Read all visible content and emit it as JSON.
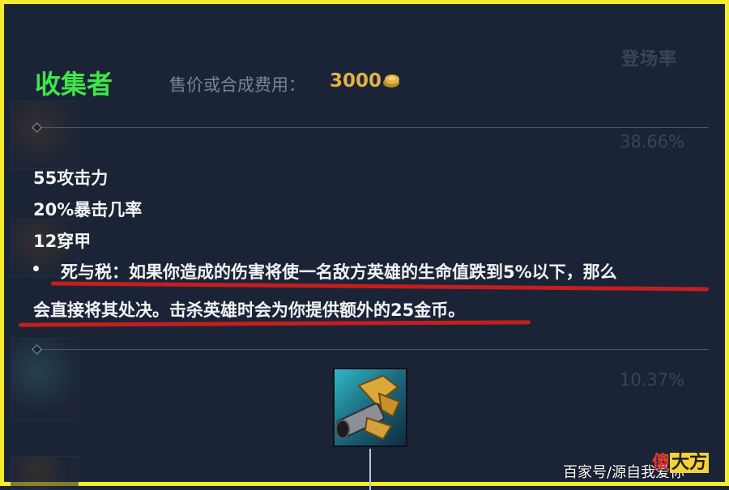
{
  "background_table": {
    "header": "登场率",
    "rates": [
      "38.66%",
      "",
      "10.37%"
    ]
  },
  "item": {
    "name": "收集者",
    "price_label": "售价或合成费用：",
    "price": "3000",
    "stats": [
      "55攻击力",
      "20%暴击几率",
      "12穿甲"
    ],
    "passive_line1": "死与税：如果你造成的伤害将使一名敌方英雄的生命值跌到5%以下，那么",
    "passive_line2": "会直接将其处决。击杀英雄时会为你提供额外的25金币。",
    "icon": "collector-icon"
  },
  "watermark": {
    "text": "百家号/源自我爱你",
    "badge_part1": "傻",
    "badge_part2": "大方"
  },
  "colors": {
    "border": "#f3ec2c",
    "title": "#3ee64a",
    "price": "#e0b247",
    "underline": "#c41e1e"
  }
}
